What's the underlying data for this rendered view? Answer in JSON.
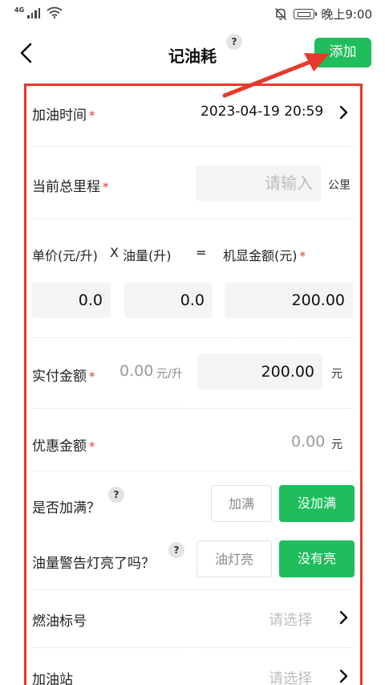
{
  "status_bar": {
    "network": "4G",
    "time": "晚上9:00"
  },
  "header": {
    "title": "记油耗",
    "help": "?",
    "add_label": "添加"
  },
  "form": {
    "fuel_time": {
      "label": "加油时间",
      "required": "*",
      "value": "2023-04-19 20:59"
    },
    "mileage": {
      "label": "当前总里程",
      "required": "*",
      "placeholder": "请输入",
      "unit": "公里"
    },
    "formula": {
      "unit_price_label": "单价(元/升)",
      "times": "X",
      "amount_label": "油量(升)",
      "equals": "=",
      "total_label": "机显金额(元)",
      "required": "*"
    },
    "unit_price_value": "0.0",
    "fuel_amount_value": "0.0",
    "machine_total_value": "200.00",
    "actual_paid": {
      "label": "实付金额",
      "required": "*",
      "price_per_liter": "0.00",
      "price_unit": "元/升",
      "value": "200.00",
      "unit": "元"
    },
    "discount": {
      "label": "优惠金额",
      "required": "*",
      "value": "0.00",
      "unit": "元"
    },
    "full_tank": {
      "label": "是否加满？",
      "help": "?",
      "option_full": "加满",
      "option_not_full": "没加满"
    },
    "warning_light": {
      "label": "油量警告灯亮了吗？",
      "help": "?",
      "option_on": "油灯亮",
      "option_off": "没有亮"
    },
    "fuel_grade": {
      "label": "燃油标号",
      "placeholder": "请选择"
    },
    "gas_station": {
      "label": "加油站",
      "placeholder": "请选择"
    }
  },
  "colors": {
    "accent": "#1fbd5c",
    "annotation": "#e53a2c"
  }
}
